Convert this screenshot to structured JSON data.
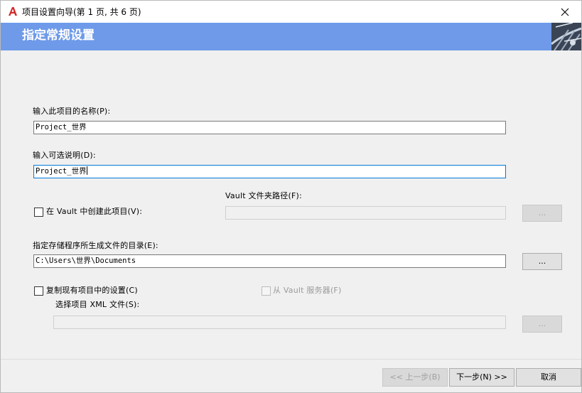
{
  "window": {
    "title": "项目设置向导(第 1 页, 共 6 页)",
    "app_icon": "autocad-a-icon",
    "close_icon": "close-icon"
  },
  "banner": {
    "title": "指定常规设置",
    "accent_color": "#6e9ae9"
  },
  "form": {
    "project_name_label": "输入此项目的名称(P):",
    "project_name_value": "Project_世界",
    "description_label": "输入可选说明(D):",
    "description_value": "Project_世界",
    "vault_checkbox_label": "在 Vault 中创建此项目(V):",
    "vault_checkbox_checked": false,
    "vault_folder_label": "Vault 文件夹路径(F):",
    "vault_folder_value": "",
    "vault_browse_label": "...",
    "output_dir_label": "指定存储程序所生成文件的目录(E):",
    "output_dir_value": "C:\\Users\\世界\\Documents",
    "output_browse_label": "...",
    "copy_settings_label": "复制现有项目中的设置(C)",
    "copy_settings_checked": false,
    "from_vault_label": "从 Vault 服务器(F)",
    "xml_file_label": "选择项目 XML 文件(S):",
    "xml_file_value": "",
    "xml_browse_label": "..."
  },
  "footer": {
    "back_label": "<< 上一步(B)",
    "next_label": "下一步(N) >>",
    "cancel_label": "取消"
  }
}
